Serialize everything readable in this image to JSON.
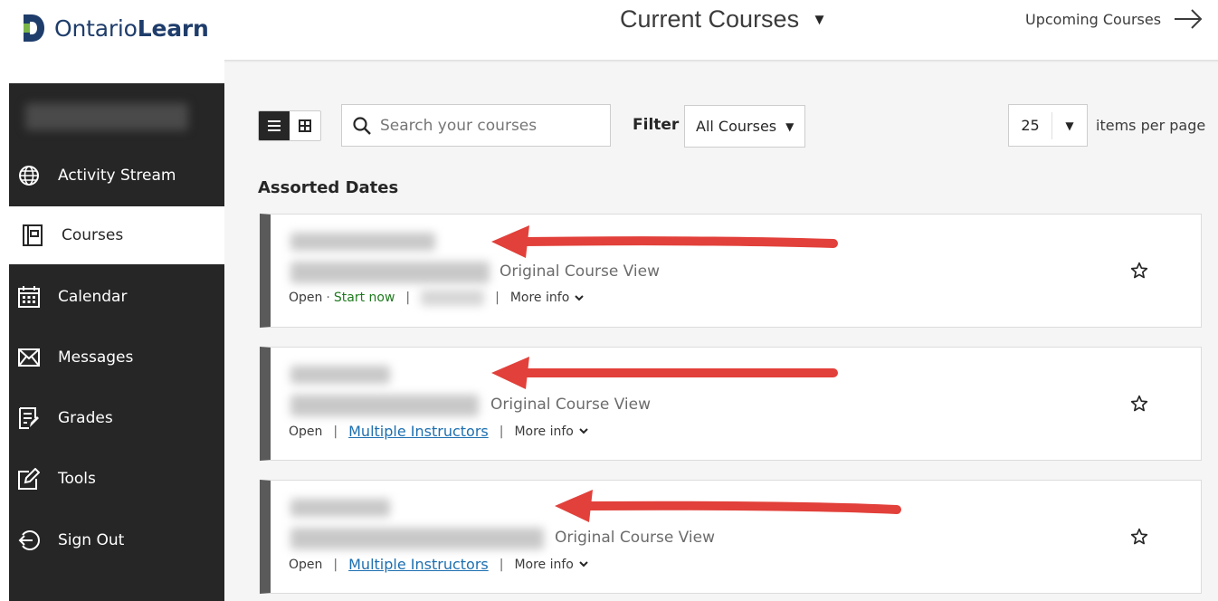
{
  "header": {
    "logo_prefix": "Ontario",
    "logo_suffix": "Learn",
    "title": "Current Courses",
    "upcoming_label": "Upcoming Courses"
  },
  "sidebar": {
    "items": [
      {
        "label": "Activity Stream",
        "icon": "globe-icon",
        "active": false
      },
      {
        "label": "Courses",
        "icon": "courses-icon",
        "active": true
      },
      {
        "label": "Calendar",
        "icon": "calendar-icon",
        "active": false
      },
      {
        "label": "Messages",
        "icon": "envelope-icon",
        "active": false
      },
      {
        "label": "Grades",
        "icon": "grades-icon",
        "active": false
      },
      {
        "label": "Tools",
        "icon": "tools-icon",
        "active": false
      },
      {
        "label": "Sign Out",
        "icon": "sign-out-icon",
        "active": false
      }
    ]
  },
  "toolbar": {
    "search_placeholder": "Search your courses",
    "filter_label": "Filter",
    "filter_value": "All Courses",
    "items_per_page_value": "25",
    "items_per_page_label": "items per page"
  },
  "group_heading": "Assorted Dates",
  "courses": [
    {
      "view": "Original Course View",
      "status": "Open",
      "start_now": "Start now",
      "instructor": "",
      "more_info": "More info"
    },
    {
      "view": "Original Course View",
      "status": "Open",
      "start_now": "",
      "instructor": "Multiple Instructors",
      "more_info": "More info"
    },
    {
      "view": "Original Course View",
      "status": "Open",
      "start_now": "",
      "instructor": "Multiple Instructors",
      "more_info": "More info"
    }
  ],
  "colors": {
    "sidebar_bg": "#262626",
    "annotation_arrow": "#e2403a",
    "link": "#1d6fb0",
    "start_now": "#1e7a1e",
    "logo": "#1f3d6b"
  }
}
